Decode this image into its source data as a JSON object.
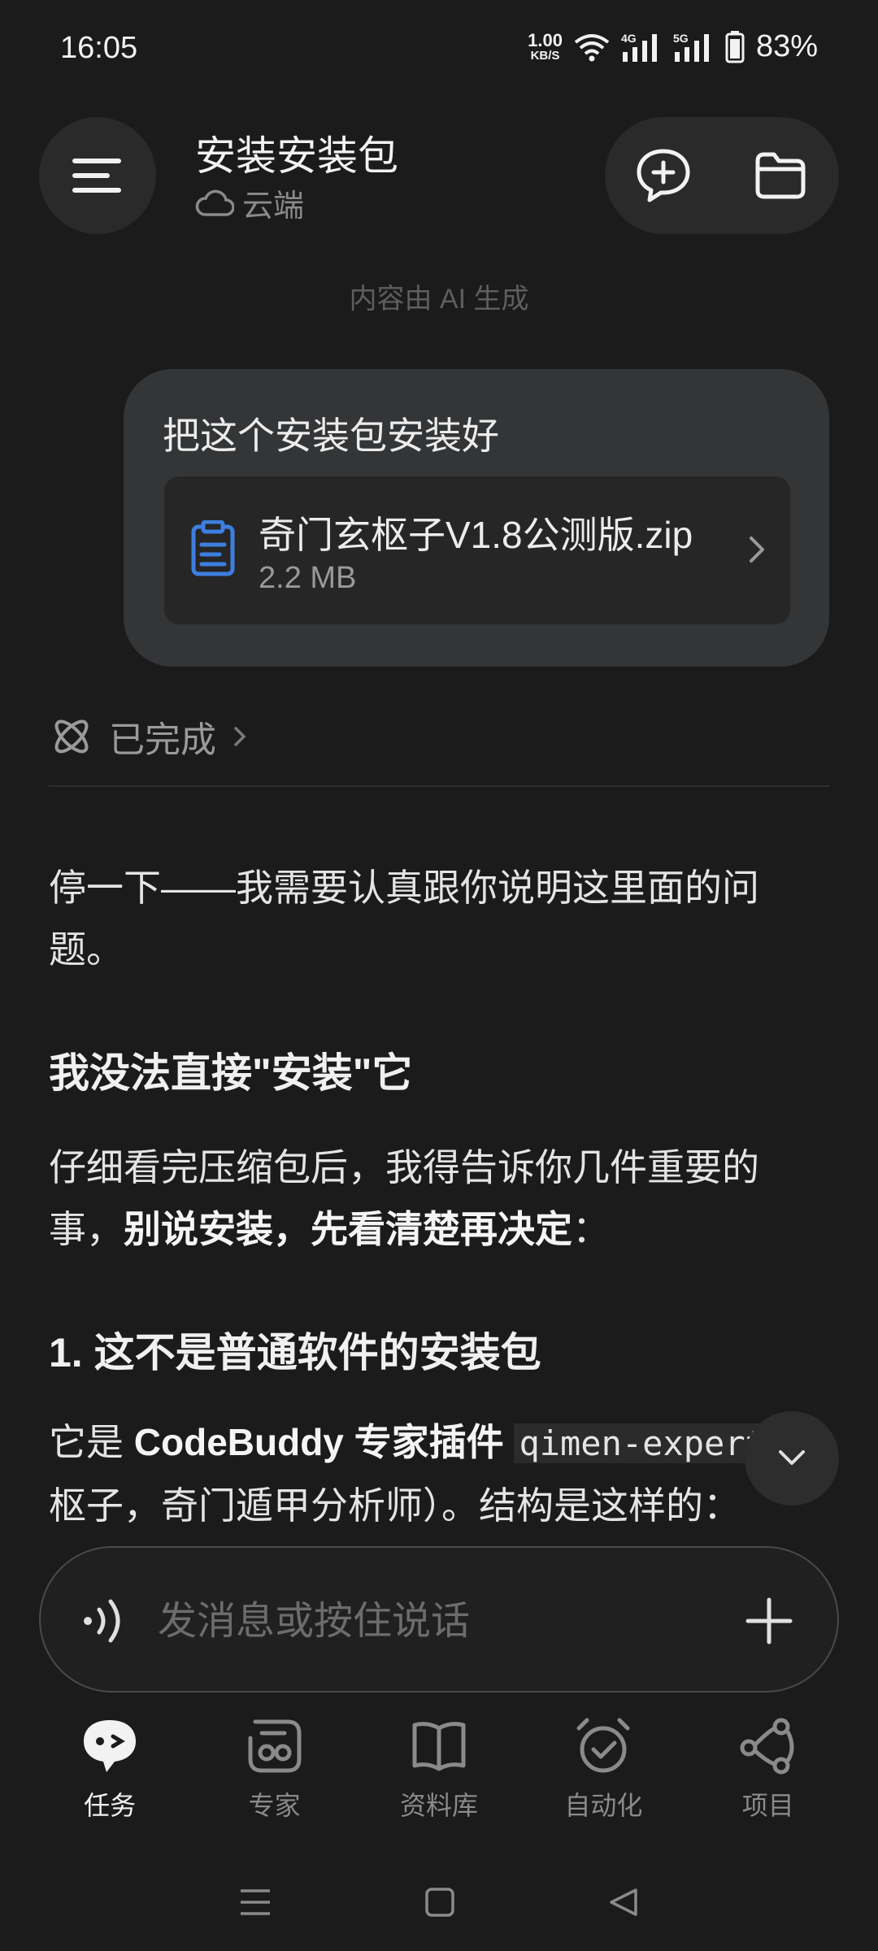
{
  "status_bar": {
    "time": "16:05",
    "net_speed_value": "1.00",
    "net_speed_unit": "KB/S",
    "battery_pct": "83%",
    "signal_1_label": "4G",
    "signal_2_label": "5G"
  },
  "header": {
    "title": "安装安装包",
    "subtitle": "云端"
  },
  "ai_note": "内容由 AI 生成",
  "user_message": {
    "text": "把这个安装包安装好",
    "attachment": {
      "name": "奇门玄枢子V1.8公测版.zip",
      "size": "2.2 MB",
      "icon": "clipboard-icon",
      "icon_color": "#3d7fe0"
    }
  },
  "status_row": {
    "label": "已完成"
  },
  "assistant": {
    "p1": "停一下——我需要认真跟你说明这里面的问题。",
    "h1": "我没法直接\"安装\"它",
    "p2_a": "仔细看完压缩包后，我得告诉你几件重要的事，",
    "p2_b": "别说安装，先看清楚再决定",
    "p2_c": "：",
    "h2": "1. 这不是普通软件的安装包",
    "p3_a": "它是 ",
    "p3_b": "CodeBuddy 专家插件",
    "p3_c": " ",
    "p3_code": "qimen-expert",
    "p3_d": "枢子，奇门遁甲分析师）。结构是这样的："
  },
  "composer": {
    "placeholder": "发消息或按住说话"
  },
  "bottom_nav": {
    "items": [
      {
        "label": "任务",
        "icon": "task-chat-icon",
        "active": true
      },
      {
        "label": "专家",
        "icon": "expert-icon",
        "active": false
      },
      {
        "label": "资料库",
        "icon": "book-icon",
        "active": false
      },
      {
        "label": "自动化",
        "icon": "alarm-check-icon",
        "active": false
      },
      {
        "label": "项目",
        "icon": "project-nodes-icon",
        "active": false
      }
    ]
  }
}
